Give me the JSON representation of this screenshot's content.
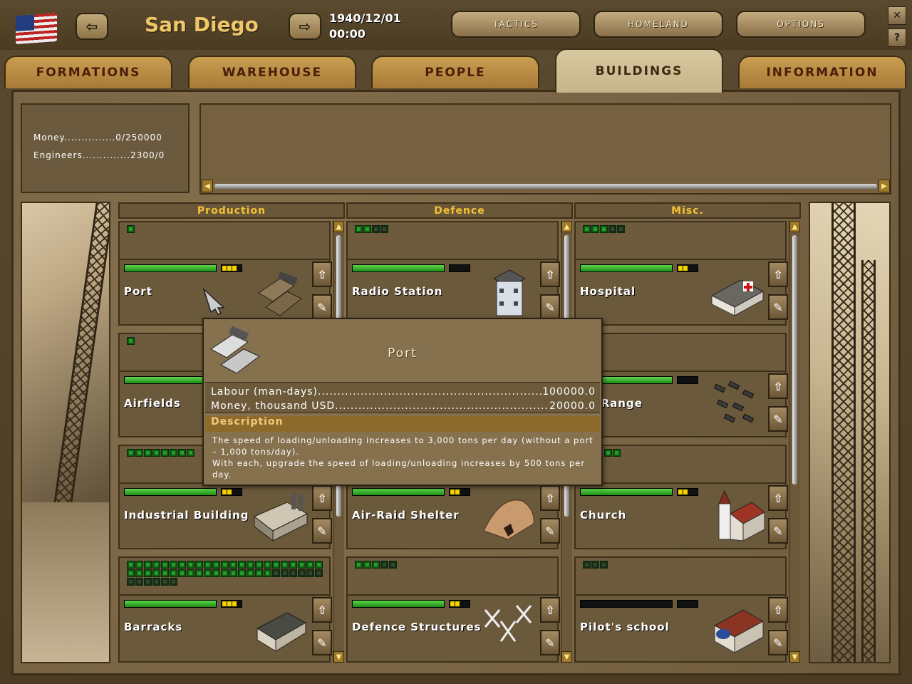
{
  "header": {
    "city": "San Diego",
    "date": "1940/12/01",
    "time": "00:00",
    "menu": [
      "TACTICS",
      "HOMELAND",
      "OPTIONS"
    ]
  },
  "tabs": [
    {
      "label": "FORMATIONS",
      "active": false
    },
    {
      "label": "WAREHOUSE",
      "active": false
    },
    {
      "label": "PEOPLE",
      "active": false
    },
    {
      "label": "BUILDINGS",
      "active": true
    },
    {
      "label": "INFORMATION",
      "active": false
    }
  ],
  "resources": {
    "money": "Money...............0/250000",
    "engineers": "Engineers..............2300/0"
  },
  "columns": [
    "Production",
    "Defence",
    "Misc."
  ],
  "buildings": {
    "production": [
      {
        "name": "Port",
        "progress": 1.0,
        "pips_on": 1,
        "pips_total": 1
      },
      {
        "name": "Airfields",
        "progress": 1.0,
        "pips_on": 1,
        "pips_total": 1
      },
      {
        "name": "Industrial Building",
        "progress": 1.0,
        "pips_on": 8,
        "pips_total": 8
      },
      {
        "name": "Barracks",
        "progress": 1.0,
        "pips_on": 40,
        "pips_total": 52
      }
    ],
    "defence": [
      {
        "name": "Radio Station",
        "progress": 1.0,
        "pips_on": 2,
        "pips_total": 4
      },
      {
        "name": "Air-Raid Shelter",
        "progress": 1.0,
        "pips_on": 0,
        "pips_total": 0
      },
      {
        "name": "Defence Structures",
        "progress": 1.0,
        "pips_on": 3,
        "pips_total": 5
      }
    ],
    "misc": [
      {
        "name": "Hospital",
        "progress": 1.0,
        "pips_on": 3,
        "pips_total": 5
      },
      {
        "name": "ng Range",
        "progress": 1.0,
        "pips_on": 2,
        "pips_total": 2
      },
      {
        "name": "Church",
        "progress": 1.0,
        "pips_on": 0,
        "pips_total": 0
      },
      {
        "name": "Pilot's school",
        "progress": 0.0,
        "pips_on": 0,
        "pips_total": 3
      }
    ]
  },
  "tooltip": {
    "title": "Port",
    "labour_label": "Labour (man-days)",
    "labour_value": "100000.0",
    "money_label": "Money, thousand USD",
    "money_value": "20000.0",
    "description_heading": "Description",
    "description": "The speed of loading/unloading increases to 3,000 tons per day (without a port – 1,000 tons/day).",
    "description2": "With each, upgrade the speed of loading/unloading increases by 500 tons per day."
  },
  "colors": {
    "accent": "#f4c232",
    "progress": "#3cb832",
    "tab_text": "#4a1e08"
  }
}
